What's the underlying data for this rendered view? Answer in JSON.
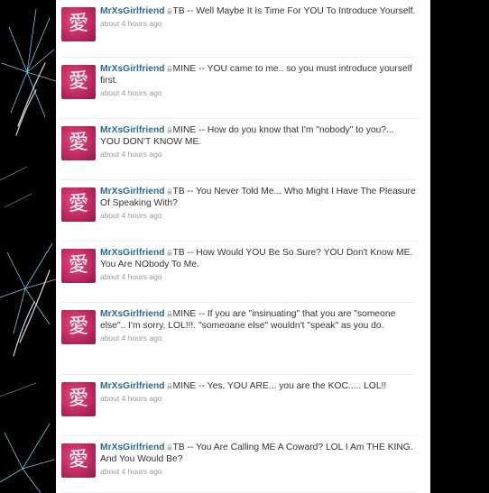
{
  "tweets": [
    {
      "user": "MrXsGirlfriend",
      "text": "TB -- Well Maybe It Is Time For YOU To Introduce Yourself.",
      "time": "about 4 hours ago"
    },
    {
      "user": "MrXsGirlfriend",
      "text": "MINE -- YOU came to me.. so you must introduce yourself first.",
      "time": "about 4 hours ago"
    },
    {
      "user": "MrXsGirlfriend",
      "text": "MINE -- How do you know that I'm \"nobody\" to you?... YOU DON'T KNOW ME.",
      "time": "about 4 hours ago"
    },
    {
      "user": "MrXsGirlfriend",
      "text": "TB -- You Never Told Me... Who Might I Have The Pleasure Of Speaking With?",
      "time": "about 4 hours ago"
    },
    {
      "user": "MrXsGirlfriend",
      "text": "TB -- How Would YOU Be So Sure? YOU Don't Know ME. You Are NObody To Me.",
      "time": "about 4 hours ago"
    },
    {
      "user": "MrXsGirlfriend",
      "text": "MINE -- If you are \"insinuating\" that you are \"someone else\".. I'm sorry, LOL!!!. \"someoane else\" wouldn't \"speak\" as you do.",
      "time": "about 4 hours ago"
    },
    {
      "user": "MrXsGirlfriend",
      "text": "MINE -- Yes, YOU ARE... you are the KOC..... LOL!!",
      "time": "about 4 hours ago"
    },
    {
      "user": "MrXsGirlfriend",
      "text": "TB -- You Are Calling ME A Coward? LOL I Am THE KING. And You Would Be?",
      "time": "about 4 hours ago"
    }
  ],
  "avatar_glyph": "愛",
  "colors": {
    "username": "#2b6c97",
    "text": "#333333",
    "meta": "#999999",
    "avatar": "#c02a62"
  },
  "icons": {
    "lock": "lock-icon"
  }
}
